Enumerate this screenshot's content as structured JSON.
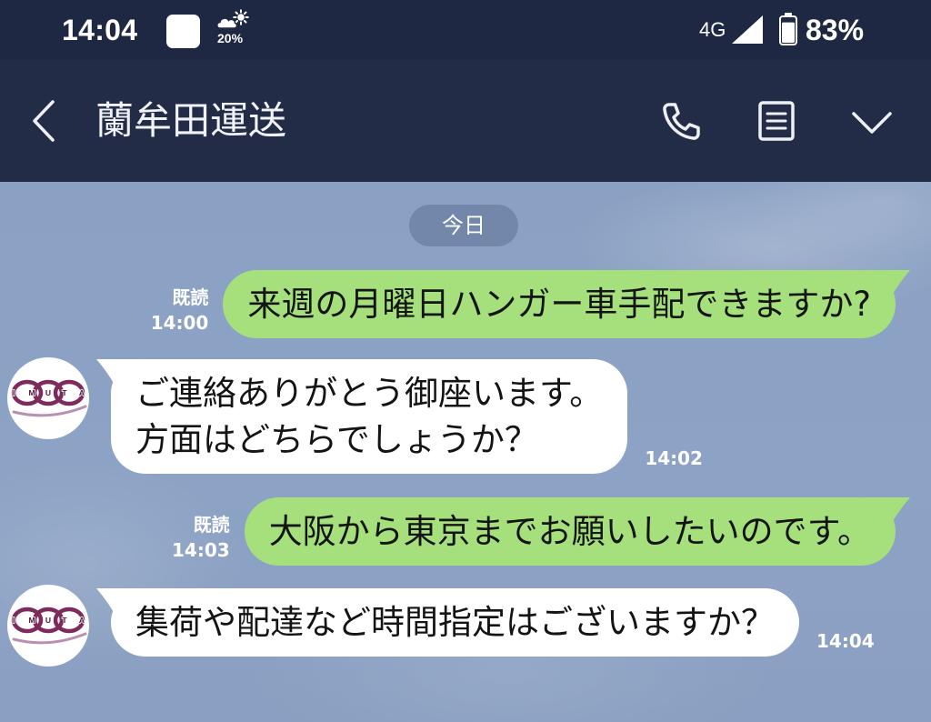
{
  "status_bar": {
    "time": "14:04",
    "notification_icon": "notification-app-icon",
    "weather": {
      "icon": "weather-cloud-sun-icon",
      "percent": "20%"
    },
    "network": "4G",
    "signal_icon": "signal-icon",
    "battery": {
      "icon": "battery-icon",
      "percent": "83%",
      "level": 0.83
    }
  },
  "header": {
    "title": "蘭牟田運送",
    "back_icon": "chevron-left-icon",
    "call_icon": "phone-icon",
    "notes_icon": "notes-icon",
    "menu_icon": "chevron-down-icon"
  },
  "chat": {
    "date_label": "今日",
    "messages": [
      {
        "read_label": "既読",
        "time": "14:00",
        "lines": [
          "来週の月曜日ハンガー車手配できますか?"
        ]
      },
      {
        "time": "14:02",
        "lines": [
          "ご連絡ありがとう御座います。",
          "方面はどちらでしょうか？"
        ]
      },
      {
        "read_label": "既読",
        "time": "14:03",
        "lines": [
          "大阪から東京までお願いしたいのです。"
        ]
      },
      {
        "time": "14:04",
        "lines": [
          "集荷や配達など時間指定はございますか？"
        ]
      }
    ]
  },
  "avatar": {
    "logo_letters": [
      "I",
      "M",
      "U",
      "T",
      "A"
    ]
  },
  "colors": {
    "status_bar": "#1f2842",
    "header": "#232c46",
    "chat_background": "#8da3c5",
    "date_pill": "#7287aa",
    "sent_bubble": "#a6e07c",
    "received_bubble": "#ffffff",
    "logo": "#7d2a5d"
  }
}
